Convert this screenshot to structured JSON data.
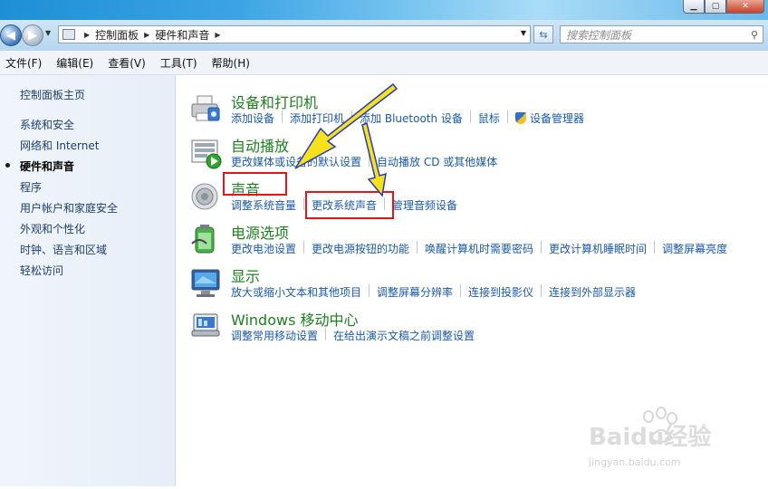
{
  "address": {
    "segments": [
      "控制面板",
      "硬件和声音"
    ]
  },
  "search": {
    "placeholder": "搜索控制面板"
  },
  "menu": [
    "文件(F)",
    "编辑(E)",
    "查看(V)",
    "工具(T)",
    "帮助(H)"
  ],
  "sidebar": {
    "home": "控制面板主页",
    "items": [
      "系统和安全",
      "网络和 Internet",
      "硬件和声音",
      "程序",
      "用户帐户和家庭安全",
      "外观和个性化",
      "时钟、语言和区域",
      "轻松访问"
    ],
    "current_index": 2
  },
  "categories": [
    {
      "title": "设备和打印机",
      "icon": "printer-icon",
      "links": [
        "添加设备",
        "添加打印机",
        "添加 Bluetooth 设备",
        "鼠标",
        "设备管理器"
      ]
    },
    {
      "title": "自动播放",
      "icon": "autoplay-icon",
      "links": [
        "更改媒体或设备的默认设置",
        "自动播放 CD 或其他媒体"
      ]
    },
    {
      "title": "声音",
      "icon": "speaker-icon",
      "links": [
        "调整系统音量",
        "更改系统声音",
        "管理音频设备"
      ]
    },
    {
      "title": "电源选项",
      "icon": "power-icon",
      "links": [
        "更改电池设置",
        "更改电源按钮的功能",
        "唤醒计算机时需要密码",
        "更改计算机睡眠时间",
        "调整屏幕亮度"
      ]
    },
    {
      "title": "显示",
      "icon": "monitor-icon",
      "links": [
        "放大或缩小文本和其他项目",
        "调整屏幕分辨率",
        "连接到投影仪",
        "连接到外部显示器"
      ]
    },
    {
      "title": "Windows 移动中心",
      "icon": "mobility-center-icon",
      "links": [
        "调整常用移动设置",
        "在给出演示文稿之前调整设置"
      ]
    }
  ],
  "watermark": {
    "brand": "Baidu经验",
    "url": "jingyan.baidu.com"
  },
  "colors": {
    "category_title": "#1e7f1e",
    "link": "#1a5aa8",
    "highlight": "#e21818",
    "arrow": "#f5e21a"
  }
}
